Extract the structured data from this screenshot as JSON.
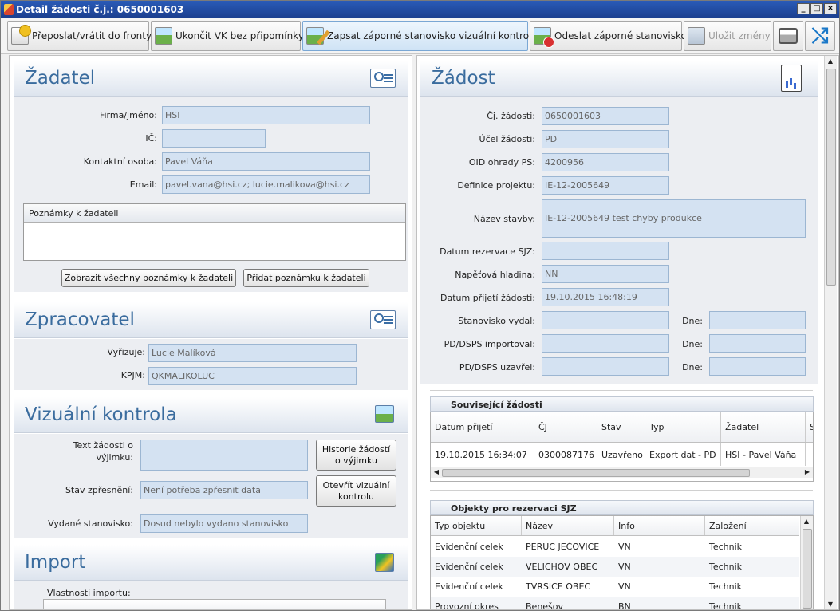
{
  "window": {
    "title": "Detail žádosti č.j.: 0650001603",
    "min": "_",
    "max": "□",
    "close": "×"
  },
  "toolbar": {
    "forward": "Přeposlat/vrátit do fronty",
    "finish_vk": "Ukončit VK bez připomínky",
    "write_negative": "Zapsat záporné stanovisko vizuální kontroly",
    "send_negative": "Odeslat záporné stanovisko",
    "save": "Uložit změny"
  },
  "zadatel": {
    "title": "Žadatel",
    "firma_label": "Firma/jméno:",
    "firma": "HSI",
    "ic_label": "IČ:",
    "ic": "",
    "kontakt_label": "Kontaktní osoba:",
    "kontakt": "Pavel Váňa",
    "email_label": "Email:",
    "email": "pavel.vana@hsi.cz; lucie.malikova@hsi.cz",
    "notes_header": "Poznámky k žadateli",
    "show_notes": "Zobrazit všechny poznámky k žadateli",
    "add_note": "Přidat poznámku k žadateli"
  },
  "zpracovatel": {
    "title": "Zpracovatel",
    "vyrizuje_label": "Vyřizuje:",
    "vyrizuje": "Lucie Malíková",
    "kpjm_label": "KPJM:",
    "kpjm": "QKMALIKOLUC"
  },
  "vizualni": {
    "title": "Vizuální kontrola",
    "text_label": "Text žádosti o výjimku:",
    "text": "",
    "historie": "Historie žádostí o výjimku",
    "stav_label": "Stav zpřesnění:",
    "stav": "Není potřeba zpřesnit data",
    "otevrit": "Otevřít vizuální kontrolu",
    "vydane_label": "Vydané stanovisko:",
    "vydane": "Dosud nebylo vydano stanovisko"
  },
  "import": {
    "title": "Import",
    "vlastnosti": "Vlastnosti importu:"
  },
  "zadost": {
    "title": "Žádost",
    "cj_label": "Čj. žádosti:",
    "cj": "0650001603",
    "ucel_label": "Účel žádosti:",
    "ucel": "PD",
    "oid_label": "OID ohrady PS:",
    "oid": "4200956",
    "definice_label": "Definice projektu:",
    "definice": "IE-12-2005649",
    "nazev_label": "Název stavby:",
    "nazev": "IE-12-2005649 test chyby produkce",
    "rezervace_label": "Datum rezervace SJZ:",
    "rezervace": "",
    "napetova_label": "Napěťová hladina:",
    "napetova": "NN",
    "prijeti_label": "Datum přijetí žádosti:",
    "prijeti": "19.10.2015 16:48:19",
    "stanovisko_label": "Stanovisko vydal:",
    "stanovisko": "",
    "importoval_label": "PD/DSPS importoval:",
    "importoval": "",
    "uzavrel_label": "PD/DSPS uzavřel:",
    "uzavrel": "",
    "dne_label": "Dne:"
  },
  "souvisejici": {
    "title": "Související žádosti",
    "headers": [
      "Datum přijetí",
      "ČJ",
      "Stav",
      "Typ",
      "Žadatel",
      "S"
    ],
    "rows": [
      [
        "19.10.2015 16:34:07",
        "0300087176",
        "Uzavřeno",
        "Export dat - PD",
        "HSI - Pavel Váňa"
      ]
    ]
  },
  "objekty": {
    "title": "Objekty pro rezervaci SJZ",
    "headers": [
      "Typ objektu",
      "Název",
      "Info",
      "Založení"
    ],
    "rows": [
      [
        "Evidenční celek",
        "PERUC JEČOVICE",
        "VN",
        "Technik"
      ],
      [
        "Evidenční celek",
        "VELICHOV OBEC",
        "VN",
        "Technik"
      ],
      [
        "Evidenční celek",
        "TVRSICE OBEC",
        "VN",
        "Technik"
      ],
      [
        "Provozní okres",
        "Benešov",
        "BN",
        "Technik"
      ]
    ]
  }
}
